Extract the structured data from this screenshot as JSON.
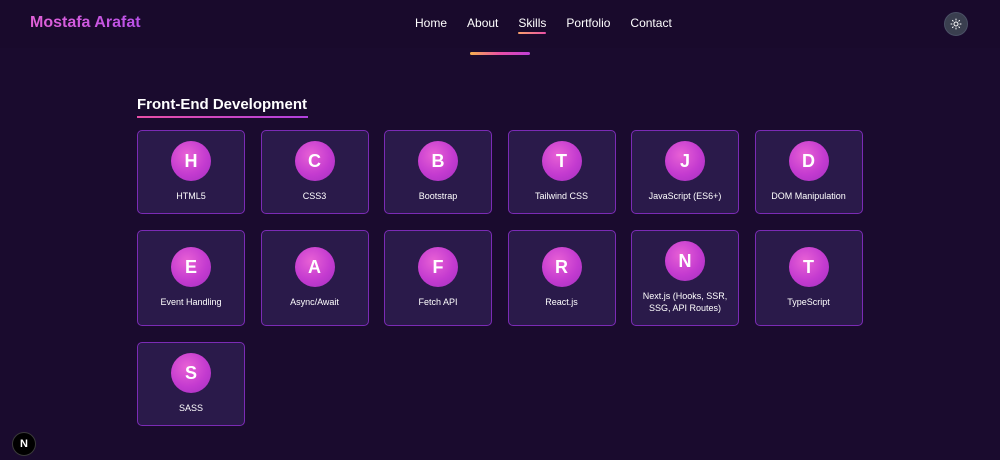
{
  "header": {
    "brand": "Mostafa Arafat",
    "nav": [
      {
        "label": "Home",
        "active": false
      },
      {
        "label": "About",
        "active": false
      },
      {
        "label": "Skills",
        "active": true
      },
      {
        "label": "Portfolio",
        "active": false
      },
      {
        "label": "Contact",
        "active": false
      }
    ],
    "theme_toggle_icon": "sun-icon"
  },
  "section": {
    "title": "Front-End Development"
  },
  "skills": [
    {
      "letter": "H",
      "label": "HTML5"
    },
    {
      "letter": "C",
      "label": "CSS3"
    },
    {
      "letter": "B",
      "label": "Bootstrap"
    },
    {
      "letter": "T",
      "label": "Tailwind CSS"
    },
    {
      "letter": "J",
      "label": "JavaScript (ES6+)"
    },
    {
      "letter": "D",
      "label": "DOM Manipulation"
    },
    {
      "letter": "E",
      "label": "Event Handling"
    },
    {
      "letter": "A",
      "label": "Async/Await"
    },
    {
      "letter": "F",
      "label": "Fetch API"
    },
    {
      "letter": "R",
      "label": "React.js"
    },
    {
      "letter": "N",
      "label": "Next.js (Hooks, SSR, SSG, API Routes)"
    },
    {
      "letter": "T",
      "label": "TypeScript"
    },
    {
      "letter": "S",
      "label": "SASS"
    }
  ],
  "dev_badge": {
    "letter": "N"
  },
  "colors": {
    "background": "#1a0b2e",
    "card": "#2a1a4a",
    "card_border": "#7b2bb5",
    "accent": "#c43bd0"
  }
}
